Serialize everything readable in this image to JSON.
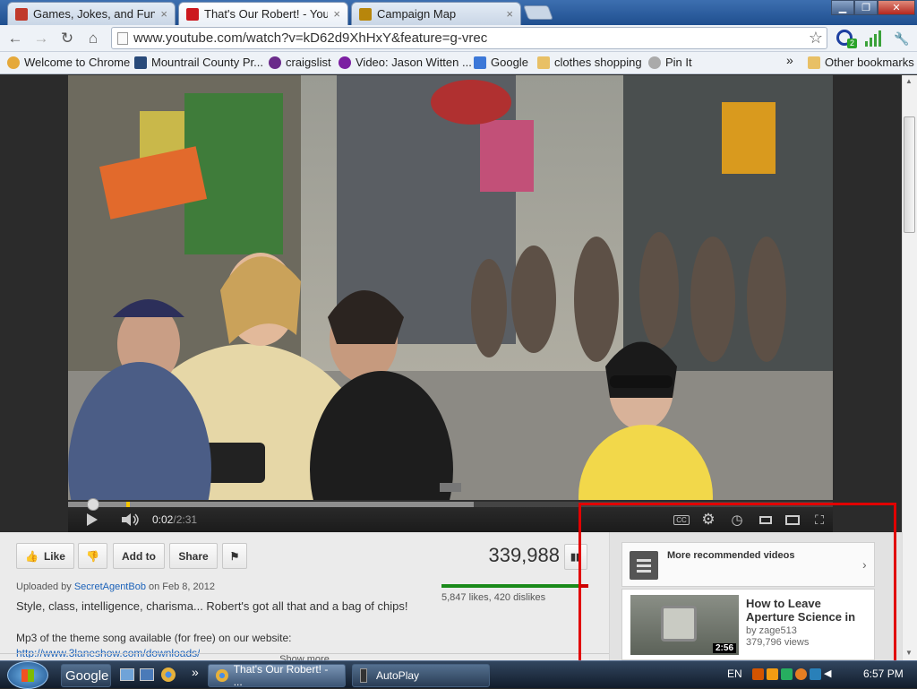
{
  "browser": {
    "tabs": [
      {
        "title": "Games, Jokes, and Fun!",
        "close": "×",
        "active": false,
        "favicon_color": "#c0392b"
      },
      {
        "title": "That's Our Robert! - YouTu",
        "close": "×",
        "active": true,
        "favicon_color": "#cc181e"
      },
      {
        "title": "Campaign Map",
        "close": "×",
        "active": false,
        "favicon_color": "#b8860b"
      }
    ],
    "window_buttons": {
      "minimize": "▁",
      "maximize": "❐",
      "close": "✕"
    },
    "url": "www.youtube.com/watch?v=kD62d9XhHxY&feature=g-vrec",
    "nav": {
      "back": "←",
      "forward": "→",
      "reload": "↻",
      "home": "⌂",
      "star": "☆",
      "wrench": "🔧"
    },
    "extension_badge": "2"
  },
  "bookmarks": {
    "items": [
      {
        "label": "Welcome to Chrome",
        "icon_color": "#e5a93b"
      },
      {
        "label": "Mountrail County Pr...",
        "icon_color": "#294a7a"
      },
      {
        "label": "craigslist",
        "icon_color": "#6a2b8a"
      },
      {
        "label": "Video: Jason Witten ...",
        "icon_color": "#7b1fa2"
      },
      {
        "label": "Google",
        "icon_color": "#3c78d8"
      },
      {
        "label": "clothes shopping",
        "icon_color": "#e8c066"
      },
      {
        "label": "Pin It",
        "icon_color": "#aaaaaa"
      }
    ],
    "overflow": "»",
    "other": "Other bookmarks"
  },
  "player": {
    "current_time": "0:02",
    "separator": " / ",
    "duration": "2:31",
    "progress_fraction": 0.02,
    "buffered_fraction": 0.53
  },
  "video_info": {
    "buttons": {
      "like": "Like",
      "add_to": "Add to",
      "share": "Share"
    },
    "views": "339,988",
    "likes_text": "5,847 likes, 420 dislikes",
    "like_ratio": 0.933,
    "uploaded_prefix": "Uploaded by ",
    "uploader": "SecretAgentBob",
    "uploaded_suffix": " on Feb 8, 2012",
    "description_line1": "Style, class, intelligence, charisma... Robert's got all that and a bag of chips!",
    "description_line2": "Mp3 of the theme song available (for free) on our website:",
    "description_link": "http://www.3laneshow.com/downloads/",
    "show_more": "Show more"
  },
  "sidebar": {
    "more_recommended": "More recommended videos",
    "chevron": "›",
    "rec_video": {
      "title": "How to Leave Aperture Science in",
      "by": "by zage513",
      "views": "379,796 views",
      "duration": "2:56"
    }
  },
  "taskbar": {
    "google": "Google",
    "overflow": "»",
    "tasks": [
      "That's Our Robert! - ...",
      "AutoPlay"
    ],
    "lang": "EN",
    "time": "6:57 PM"
  },
  "colors": {
    "highlight_box": "#e10000",
    "youtube_red": "#cc181e",
    "link_blue": "#1c62b9"
  }
}
